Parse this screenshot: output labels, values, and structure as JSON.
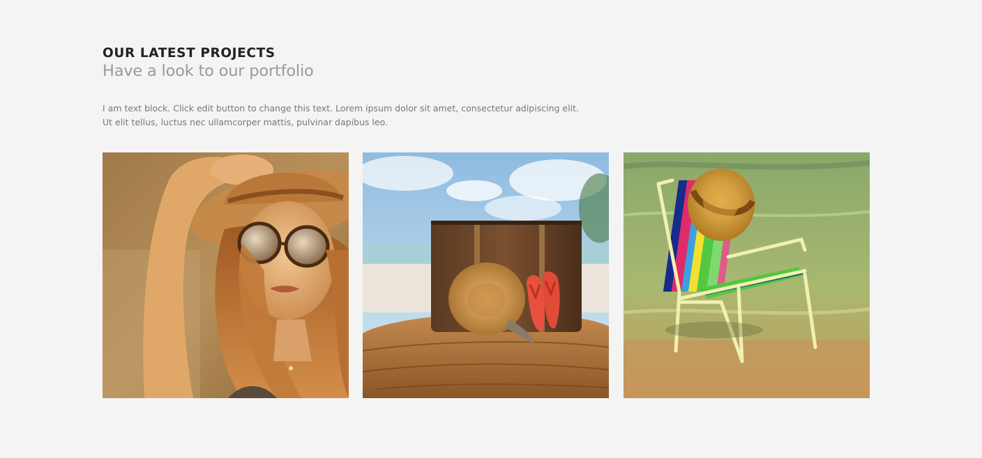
{
  "header": {
    "title": "OUR LATEST PROJECTS",
    "subtitle": "Have a look to our portfolio"
  },
  "intro": {
    "lines": [
      "I am text block. Click edit button to change this text. Lorem ipsum dolor sit amet, consectetur adipiscing elit.",
      "Ut elit tellus, luctus nec ullamcorper mattis, pulvinar dapibus leo."
    ]
  },
  "portfolio": {
    "items": [
      {
        "subject": "woman-with-sunglasses-and-straw-hat"
      },
      {
        "subject": "suitcase-straw-hat-and-flip-flops-on-beach"
      },
      {
        "subject": "striped-beach-chair-with-hat-in-sea"
      }
    ]
  },
  "colors": {
    "background": "#f4f4f4",
    "title": "#222222",
    "subtitle": "#9a9a9a",
    "body_text": "#777777"
  }
}
